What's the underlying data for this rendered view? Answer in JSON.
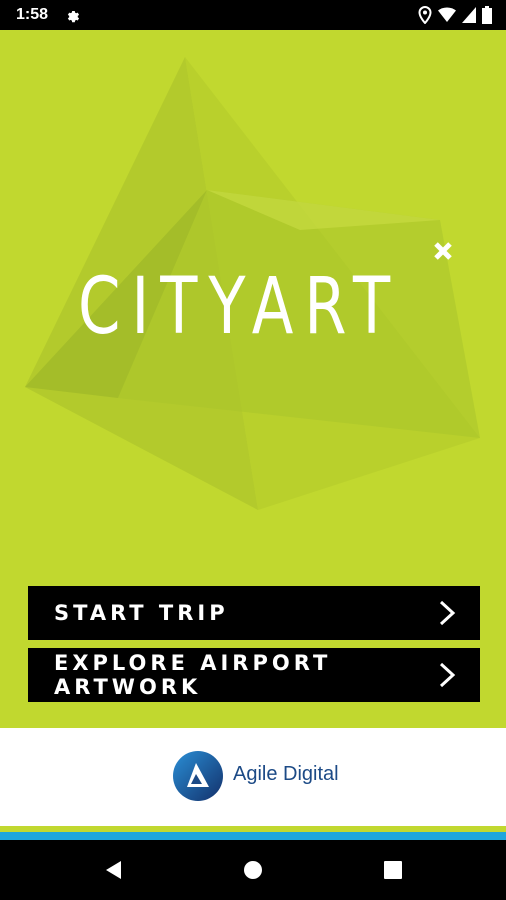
{
  "status_bar": {
    "time": "1:58",
    "icons": [
      "gear-icon",
      "location-icon",
      "wifi-icon",
      "signal-icon",
      "battery-icon"
    ]
  },
  "hero": {
    "logo_text": "CITYART",
    "logo_mark": "x-icon",
    "background_color": "#c1d82f"
  },
  "menu": {
    "items": [
      {
        "label": "START TRIP",
        "icon": "chevron-right-icon"
      },
      {
        "label": "EXPLORE AIRPORT ARTWORK",
        "icon": "chevron-right-icon"
      }
    ]
  },
  "footer": {
    "brand_name": "Agile Digital",
    "brand_color": "#1c4a86",
    "stripe_colors": [
      "#c1d82f",
      "#1ea6dc"
    ]
  },
  "nav_bar": {
    "buttons": [
      "back-icon",
      "home-icon",
      "recents-icon"
    ]
  }
}
